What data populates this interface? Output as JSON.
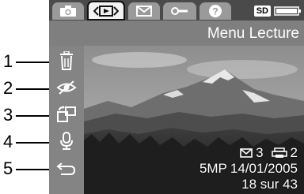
{
  "callouts": [
    "1",
    "2",
    "3",
    "4",
    "5"
  ],
  "tabs": [
    {
      "icon": "camera-icon",
      "active": false
    },
    {
      "icon": "playback-icon",
      "active": true
    },
    {
      "icon": "envelope-icon",
      "active": false
    },
    {
      "icon": "wrench-icon",
      "active": false
    },
    {
      "icon": "help-icon",
      "active": false
    }
  ],
  "status": {
    "memory_card": "SD",
    "battery_icon": "battery-icon"
  },
  "page_title": "Menu Lecture",
  "menu_items": [
    {
      "icon": "trash-icon"
    },
    {
      "icon": "red-eye-removal-icon"
    },
    {
      "icon": "rotate-icon"
    },
    {
      "icon": "microphone-icon"
    },
    {
      "icon": "back-arrow-icon"
    }
  ],
  "photo_info": {
    "share_count": "3",
    "print_count": "2",
    "resolution": "5MP",
    "date": "14/01/2005",
    "position": "18 sur 43"
  },
  "colors": {
    "accent_active_tab": "#f2f2f2",
    "menu_column": "#848484",
    "title_strip": "#7f7f7f"
  }
}
